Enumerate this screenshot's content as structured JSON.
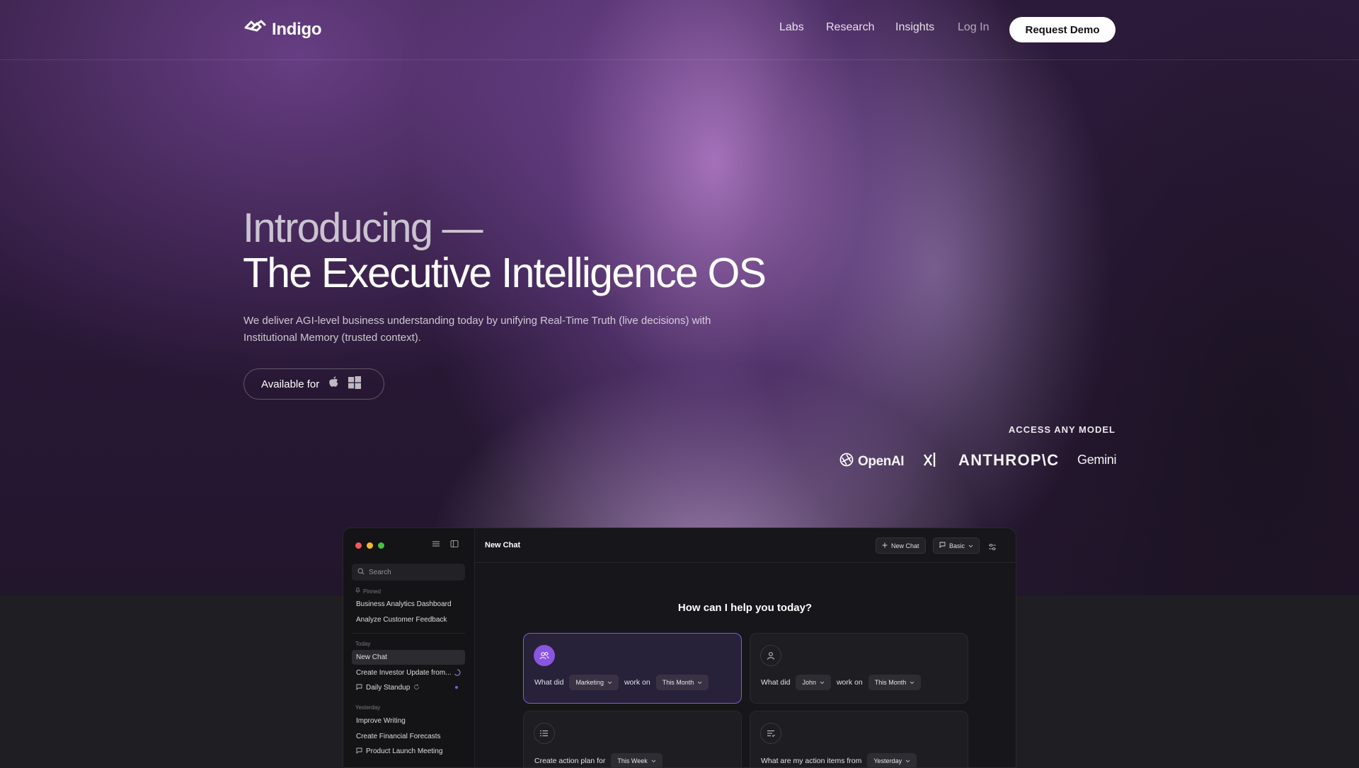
{
  "brand": {
    "name": "Indigo"
  },
  "nav": {
    "links": [
      "Labs",
      "Research",
      "Insights",
      "Log In"
    ],
    "cta": "Request Demo"
  },
  "hero": {
    "intro": "Introducing —",
    "headline": "The Executive Intelligence OS",
    "description": "We deliver AGI-level business understanding today by unifying Real-Time Truth (live decisions) with Institutional Memory (trusted context).",
    "available_label": "Available for",
    "platform_icons": [
      "apple-icon",
      "windows-icon"
    ]
  },
  "models": {
    "heading": "ACCESS ANY MODEL",
    "logos": [
      "OpenAI",
      "xAI",
      "ANTHROP\\C",
      "Gemini"
    ]
  },
  "app": {
    "search_placeholder": "Search",
    "sidebar": {
      "pinned_label": "Pinned",
      "pinned": [
        "Business Analytics Dashboard",
        "Analyze Customer Feedback"
      ],
      "today_label": "Today",
      "today": [
        "New Chat",
        "Create Investor Update from...",
        "Daily Standup"
      ],
      "yesterday_label": "Yesterday",
      "yesterday": [
        "Improve Writing",
        "Create Financial Forecasts",
        "Product Launch Meeting"
      ]
    },
    "chat_title": "New Chat",
    "header_buttons": {
      "new_chat": "New Chat",
      "mode": "Basic"
    },
    "prompt": "How can I help you today?",
    "cards": [
      {
        "parts": [
          "What did",
          "Marketing",
          "work on",
          "This Month"
        ]
      },
      {
        "parts": [
          "What did",
          "John",
          "work on",
          "This Month"
        ]
      },
      {
        "parts": [
          "Create action plan for",
          "This Week"
        ]
      },
      {
        "parts": [
          "What are my action items from",
          "Yesterday"
        ]
      }
    ]
  },
  "colors": {
    "accent": "#8a55e0",
    "background": "#1f1e22",
    "hero_glow": "#d69cee"
  }
}
